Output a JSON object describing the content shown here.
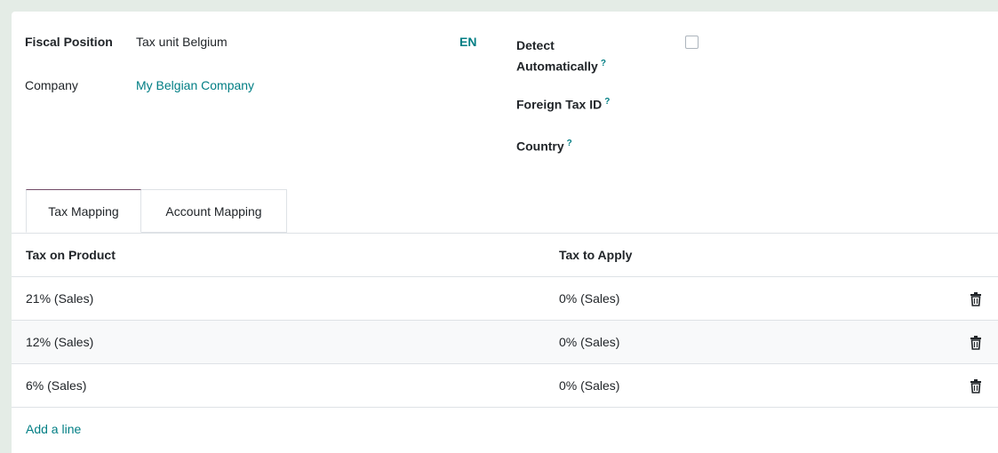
{
  "form": {
    "fiscal_position_label": "Fiscal Position",
    "fiscal_position_value": "Tax unit Belgium",
    "lang_badge": "EN",
    "company_label": "Company",
    "company_value": "My Belgian Company",
    "detect_label_line1": "Detect",
    "detect_label_line2": "Automatically",
    "detect_checked": false,
    "foreign_tax_label": "Foreign Tax ID",
    "country_label": "Country",
    "help_mark": "?"
  },
  "tabs": [
    {
      "label": "Tax Mapping",
      "active": true
    },
    {
      "label": "Account Mapping",
      "active": false
    }
  ],
  "table": {
    "headers": [
      "Tax on Product",
      "Tax to Apply"
    ],
    "rows": [
      {
        "product_tax": "21% (Sales)",
        "apply_tax": "0% (Sales)"
      },
      {
        "product_tax": "12% (Sales)",
        "apply_tax": "0% (Sales)"
      },
      {
        "product_tax": "6% (Sales)",
        "apply_tax": "0% (Sales)"
      }
    ],
    "add_line": "Add a line"
  },
  "colors": {
    "accent": "#017e84",
    "tab_active_border": "#714b67",
    "background": "#e4ece6"
  },
  "icons": {
    "delete": "trash-icon"
  }
}
